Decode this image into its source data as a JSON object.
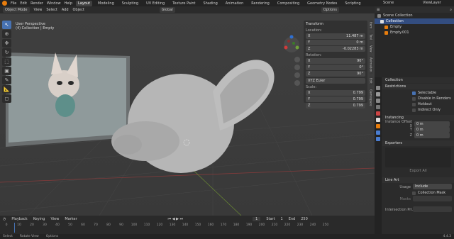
{
  "topbar": {
    "menus": [
      "File",
      "Edit",
      "Render",
      "Window",
      "Help"
    ],
    "workspaces": [
      "Layout",
      "Modeling",
      "Sculpting",
      "UV Editing",
      "Texture Paint",
      "Shading",
      "Animation",
      "Rendering",
      "Compositing",
      "Geometry Nodes",
      "Scripting"
    ],
    "active_workspace": "Layout",
    "scene": "Scene",
    "view_layer": "ViewLayer"
  },
  "viewport_header": {
    "mode": "Object Mode",
    "menus": [
      "View",
      "Select",
      "Add",
      "Object"
    ],
    "orientation": "Global",
    "options_label": "Options"
  },
  "viewport": {
    "perspective_label": "User Perspective",
    "context_label": "(4) Collection | Empty"
  },
  "npanel": {
    "section": "Transform",
    "location_label": "Location:",
    "location": [
      [
        "X",
        "11.487 m"
      ],
      [
        "Y",
        "0 m"
      ],
      [
        "Z",
        "-0.02283 m"
      ]
    ],
    "rotation_label": "Rotation:",
    "rotation": [
      [
        "X",
        "90°"
      ],
      [
        "Y",
        "0°"
      ],
      [
        "Z",
        "90°"
      ]
    ],
    "rotation_mode": "XYZ Euler",
    "scale_label": "Scale:",
    "scale": [
      [
        "X",
        "0.799"
      ],
      [
        "Y",
        "0.799"
      ],
      [
        "Z",
        "0.799"
      ]
    ],
    "tabs": [
      "Item",
      "Tool",
      "View",
      "Animation",
      "Edit",
      "Gamespace"
    ]
  },
  "outliner": {
    "title": "Scene Collection",
    "items": [
      {
        "label": "Collection",
        "selected": true
      },
      {
        "label": "Empty",
        "selected": false
      },
      {
        "label": "Empty.001",
        "selected": false
      }
    ]
  },
  "properties": {
    "header": "Collection",
    "restrictions_label": "Restrictions",
    "restrictions": [
      {
        "label": "Selectable",
        "on": true
      },
      {
        "label": "Disable in Renders",
        "on": false
      },
      {
        "label": "Holdout",
        "on": false
      },
      {
        "label": "Indirect Only",
        "on": false
      }
    ],
    "instancing_label": "Instancing",
    "instance_offset_label": "Instance Offset X",
    "instance_offset": [
      [
        "X",
        "0 m"
      ],
      [
        "Y",
        "0 m"
      ],
      [
        "Z",
        "0 m"
      ]
    ],
    "exporters_label": "Exporters",
    "export_all_label": "Export All",
    "lineart_label": "Line Art",
    "usage_label": "Usage",
    "usage_value": "Include",
    "collection_mask_label": "Collection Mask",
    "masks_label": "Masks",
    "intersection_label": "Intersection Pri..."
  },
  "timeline": {
    "menus": [
      "Playback",
      "Keying",
      "View",
      "Marker"
    ],
    "current_frame": "1",
    "start_label": "Start",
    "start": "1",
    "end_label": "End",
    "end": "250",
    "ticks": [
      "0",
      "10",
      "20",
      "30",
      "40",
      "50",
      "60",
      "70",
      "80",
      "90",
      "100",
      "110",
      "120",
      "130",
      "140",
      "150",
      "160",
      "170",
      "180",
      "190",
      "200",
      "210",
      "220",
      "230",
      "240",
      "250"
    ]
  },
  "statusbar": {
    "items": [
      "Select",
      "Rotate View",
      "Options"
    ],
    "version": "4.4.3"
  },
  "colors": {
    "accent": "#4772b3",
    "orange": "#e87d0d",
    "model": "#b6b6b6"
  }
}
